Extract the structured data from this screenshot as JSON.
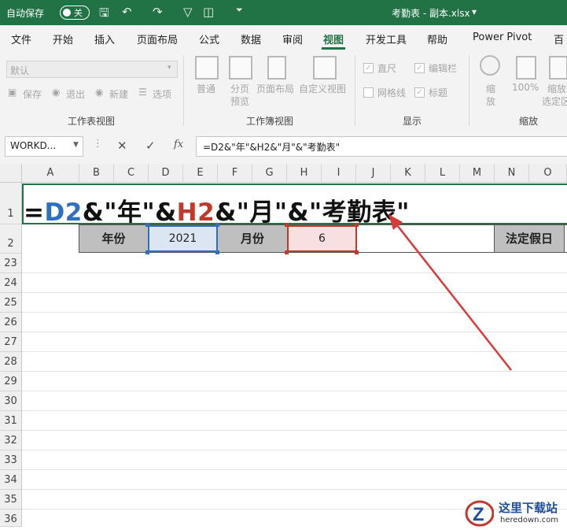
{
  "titlebar": {
    "autosave_label": "自动保存",
    "autosave_state": "关",
    "filename": "考勤表 - 副本.xlsx",
    "filename_dropdown": "▾"
  },
  "tabs": [
    "文件",
    "开始",
    "插入",
    "页面布局",
    "公式",
    "数据",
    "审阅",
    "视图",
    "开发工具",
    "帮助",
    "Power Pivot",
    "百"
  ],
  "active_tab": "视图",
  "ribbon": {
    "sheetview_dropdown": "默认",
    "keep": "保存",
    "exit": "退出",
    "new": "新建",
    "options": "选项",
    "group1": "工作表视图",
    "normal": "普通",
    "pagebreak_1": "分页",
    "pagebreak_2": "预览",
    "pagelayout": "页面布局",
    "customview": "自定义视图",
    "group2": "工作簿视图",
    "ruler": "直尺",
    "formulabar": "编辑栏",
    "gridlines": "网格线",
    "headings": "标题",
    "group3": "显示",
    "zoom_1": "缩",
    "zoom_2": "放",
    "zoom100": "100%",
    "zoomsel_1": "缩放",
    "zoomsel_2": "选定区",
    "group4": "缩放"
  },
  "formulabar": {
    "namebox": "WORKD...",
    "cancel": "✕",
    "enter": "✓",
    "fx": "fx",
    "formula": "=D2&\"年\"&H2&\"月\"&\"考勤表\""
  },
  "grid": {
    "columns": [
      "A",
      "B",
      "C",
      "D",
      "E",
      "F",
      "G",
      "H",
      "I",
      "J",
      "K",
      "L",
      "M",
      "N",
      "O"
    ],
    "rows": [
      "1",
      "2",
      "23",
      "24",
      "25",
      "26",
      "27",
      "28",
      "29",
      "30",
      "31",
      "32",
      "33",
      "34",
      "35",
      "36"
    ],
    "b2_label": "年份",
    "d2_value": "2021",
    "f2_label": "月份",
    "h2_value": "6",
    "n2_label": "法定假日",
    "formula_parts": [
      "=",
      "D2",
      "&\"年\"&",
      "H2",
      "&\"月\"&\"考勤表\""
    ]
  },
  "colors": {
    "excel_green": "#217346",
    "ref_blue": "#2f6fbf",
    "ref_red": "#c0392b",
    "arrow_red": "#d93a3a"
  },
  "watermark": {
    "title": "这里下载站",
    "sub": "heredown.com"
  }
}
